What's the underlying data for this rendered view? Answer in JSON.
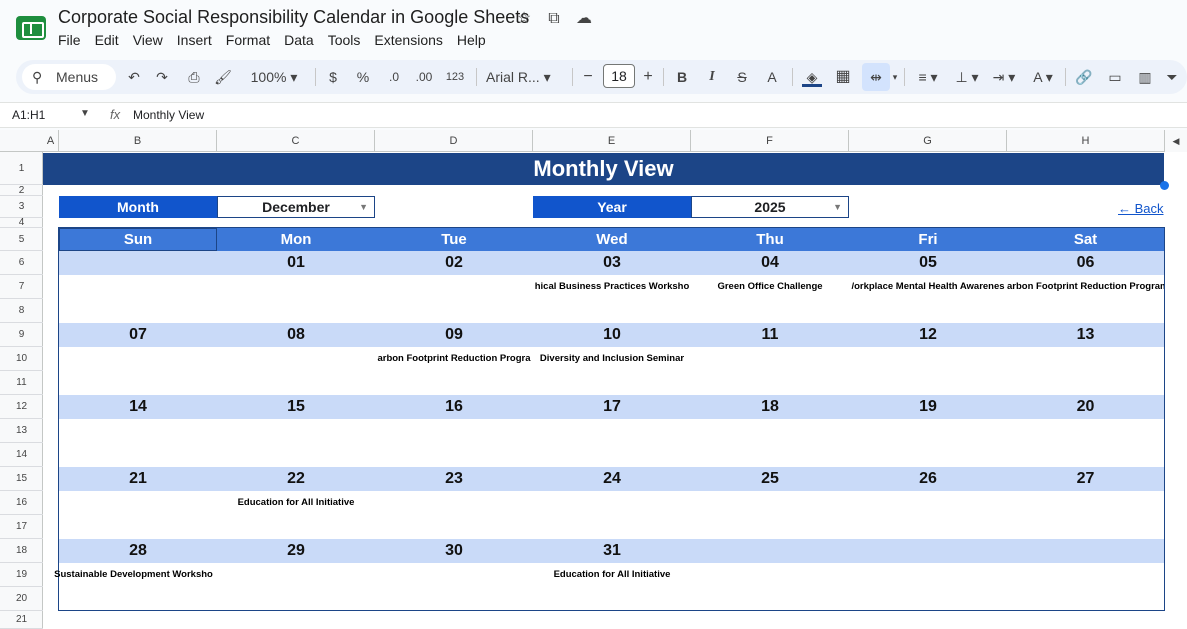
{
  "app": {
    "title": "Corporate Social Responsibility Calendar in Google Sheets",
    "menu": [
      "File",
      "Edit",
      "View",
      "Insert",
      "Format",
      "Data",
      "Tools",
      "Extensions",
      "Help"
    ]
  },
  "toolbar": {
    "search_label": "Menus",
    "zoom": "100%",
    "currency": "$",
    "percent": "%",
    "dec_less": ".0",
    "dec_more": ".00",
    "number_format": "123",
    "font": "Arial R...",
    "font_size": "18"
  },
  "formula_bar": {
    "name_box": "A1:H1",
    "fx": "fx",
    "content": "Monthly View"
  },
  "grid": {
    "columns": [
      "A",
      "B",
      "C",
      "D",
      "E",
      "F",
      "G",
      "H"
    ],
    "rows": [
      "1",
      "2",
      "3",
      "4",
      "5",
      "6",
      "7",
      "8",
      "9",
      "10",
      "11",
      "12",
      "13",
      "14",
      "15",
      "16",
      "17",
      "18",
      "19",
      "20",
      "21"
    ]
  },
  "sheet": {
    "banner": "Monthly View",
    "month_label": "Month",
    "month_value": "December",
    "year_label": "Year",
    "year_value": "2025",
    "back_link": "← Back",
    "day_names": [
      "Sun",
      "Mon",
      "Tue",
      "Wed",
      "Thu",
      "Fri",
      "Sat"
    ],
    "weeks": [
      {
        "dates": [
          "",
          "01",
          "02",
          "03",
          "04",
          "05",
          "06"
        ],
        "events": [
          "",
          "",
          "",
          "hical Business Practices Worksho",
          "Green Office Challenge",
          "/orkplace Mental Health Awarenes",
          "arbon Footprint Reduction Program"
        ]
      },
      {
        "dates": [
          "07",
          "08",
          "09",
          "10",
          "11",
          "12",
          "13"
        ],
        "events": [
          "",
          "",
          "arbon Footprint Reduction Progra",
          "Diversity and Inclusion Seminar",
          "",
          "",
          ""
        ]
      },
      {
        "dates": [
          "14",
          "15",
          "16",
          "17",
          "18",
          "19",
          "20"
        ],
        "events": [
          "",
          "",
          "",
          "",
          "",
          "",
          ""
        ]
      },
      {
        "dates": [
          "21",
          "22",
          "23",
          "24",
          "25",
          "26",
          "27"
        ],
        "events": [
          "",
          "Education for All Initiative",
          "",
          "",
          "",
          "",
          ""
        ]
      },
      {
        "dates": [
          "28",
          "29",
          "30",
          "31",
          "",
          "",
          ""
        ],
        "events": [
          "Sustainable Development Worksho",
          "",
          "",
          "Education for All Initiative",
          "",
          "",
          ""
        ]
      }
    ]
  },
  "colors": {
    "banner": "#1c4587",
    "label_blue": "#1155cc",
    "day_header": "#3c78d8",
    "week_band": "#c9daf8"
  }
}
